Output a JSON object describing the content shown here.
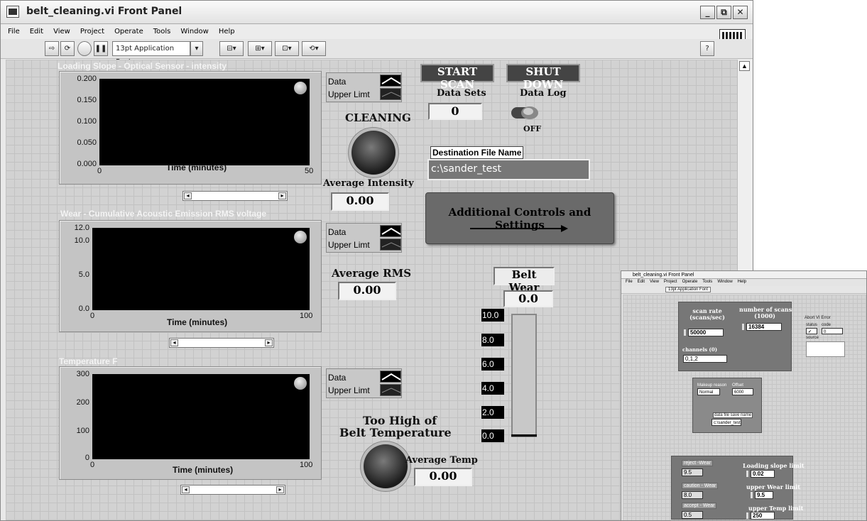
{
  "window": {
    "title": "belt_cleaning.vi Front Panel",
    "min": "_",
    "max": "⧉",
    "close": "✕"
  },
  "menu": [
    "File",
    "Edit",
    "View",
    "Project",
    "Operate",
    "Tools",
    "Window",
    "Help"
  ],
  "toolbar": {
    "font": "13pt Application Font",
    "help": "?",
    "connector": "1"
  },
  "charts": [
    {
      "label": "Loading Slope - Optical Sensor - intensity",
      "xlabel": "Time (minutes)",
      "yticks": [
        "0.200",
        "0.150",
        "0.100",
        "0.050",
        "0.000"
      ],
      "xmin": "0",
      "xmax": "50"
    },
    {
      "label": "Wear - Cumulative Acoustic Emission RMS voltage",
      "xlabel": "Time (minutes)",
      "yticks": [
        "12.0",
        "10.0",
        "5.0",
        "0.0"
      ],
      "xmin": "0",
      "xmax": "100"
    },
    {
      "label": "Temperature F",
      "xlabel": "Time (minutes)",
      "yticks": [
        "300",
        "200",
        "100",
        "0"
      ],
      "xmin": "0",
      "xmax": "100"
    }
  ],
  "legend": {
    "data": "Data",
    "upper": "Upper Limt"
  },
  "cleaning": {
    "label": "CLEANING"
  },
  "avg_intensity": {
    "label": "Average Intensity",
    "value": "0.00"
  },
  "avg_rms": {
    "label": "Average RMS",
    "value": "0.00"
  },
  "too_high": {
    "line1": "Too High of",
    "line2": "Belt Temperature"
  },
  "avg_temp": {
    "label": "Average Temp",
    "value": "0.00"
  },
  "buttons": {
    "start": "START SCAN",
    "shutdown": "SHUT DOWN"
  },
  "data_sets": {
    "label": "Data Sets",
    "value": "0"
  },
  "data_log": {
    "label": "Data Log",
    "state": "OFF"
  },
  "dest_file": {
    "label": "Destination File Name",
    "value": "c:\\sander_test"
  },
  "additional": {
    "label": "Additional Controls and Settings"
  },
  "belt_wear": {
    "label": "Belt Wear",
    "value": "0.0",
    "ticks": [
      "10.0",
      "8.0",
      "6.0",
      "4.0",
      "2.0",
      "0.0"
    ],
    "level": 0.0,
    "max": 10.0
  },
  "inset": {
    "title": "belt_cleaning.vi Front Panel",
    "menu": [
      "File",
      "Edit",
      "View",
      "Project",
      "Operate",
      "Tools",
      "Window",
      "Help"
    ],
    "font": "13pt Application Font",
    "scan_rate": {
      "label1": "scan rate",
      "label2": "(scans/sec)",
      "value": "50000"
    },
    "num_scans": {
      "label1": "number of scans",
      "label2": "(1000)",
      "value": "16384"
    },
    "channels": {
      "label": "channels (0)",
      "value": "0,1,2"
    },
    "abort": {
      "title": "Abort VI Error",
      "status": "status",
      "code": "code",
      "source": "source",
      "check": "✓",
      "code_val": "0"
    },
    "makeup": {
      "label": "Makeup reason",
      "value": "Normal"
    },
    "offset": {
      "label": "Offset",
      "value": "6000"
    },
    "file": {
      "label1": "data file save name",
      "value": "c:\\sander_test"
    },
    "reject": {
      "label": "reject -Wear",
      "value": "9.5"
    },
    "caution": {
      "label": "caution - Wear",
      "value": "8.0"
    },
    "accept": {
      "label": "accept - Wear",
      "value": "0.5"
    },
    "loading_limit": {
      "label": "Loading slope limit",
      "value": "0.02"
    },
    "wear_limit": {
      "label": "upper Wear limit",
      "value": "9.5"
    },
    "temp_limit": {
      "label": "upper Temp limit",
      "value": "250"
    }
  },
  "colors": {
    "panel": "#d2d2d2",
    "plot": "#000000",
    "button": "#444444",
    "additional": "#6a6a6a"
  }
}
